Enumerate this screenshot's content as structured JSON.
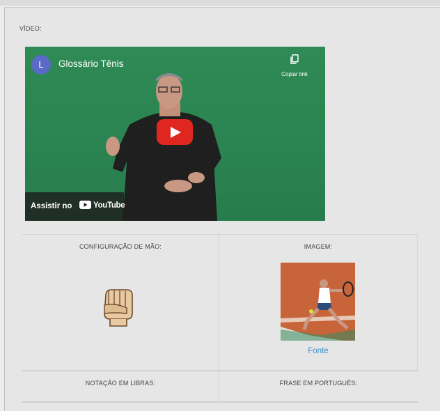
{
  "video_section": {
    "label": "VÍDEO:",
    "channel_initial": "L",
    "title": "Glossário Tênis",
    "copy_label": "Copiar link",
    "watch_on": "Assistir no",
    "platform": "YouTube"
  },
  "cells": {
    "hand_config_label": "CONFIGURAÇÃO DE MÃO:",
    "image_label": "IMAGEM:",
    "source_link": "Fonte",
    "notation_label": "NOTAÇÃO EM LIBRAS:",
    "phrase_label": "FRASE EM PORTUGUÊS:"
  },
  "icons": [
    "copy-icon",
    "play-icon",
    "youtube-logo-icon",
    "closed-fist-hand-icon"
  ],
  "colors": {
    "video_bg": "#2b8451",
    "play_button": "#e0271f",
    "link": "#3c8fc4",
    "avatar": "#5a6bc7"
  }
}
